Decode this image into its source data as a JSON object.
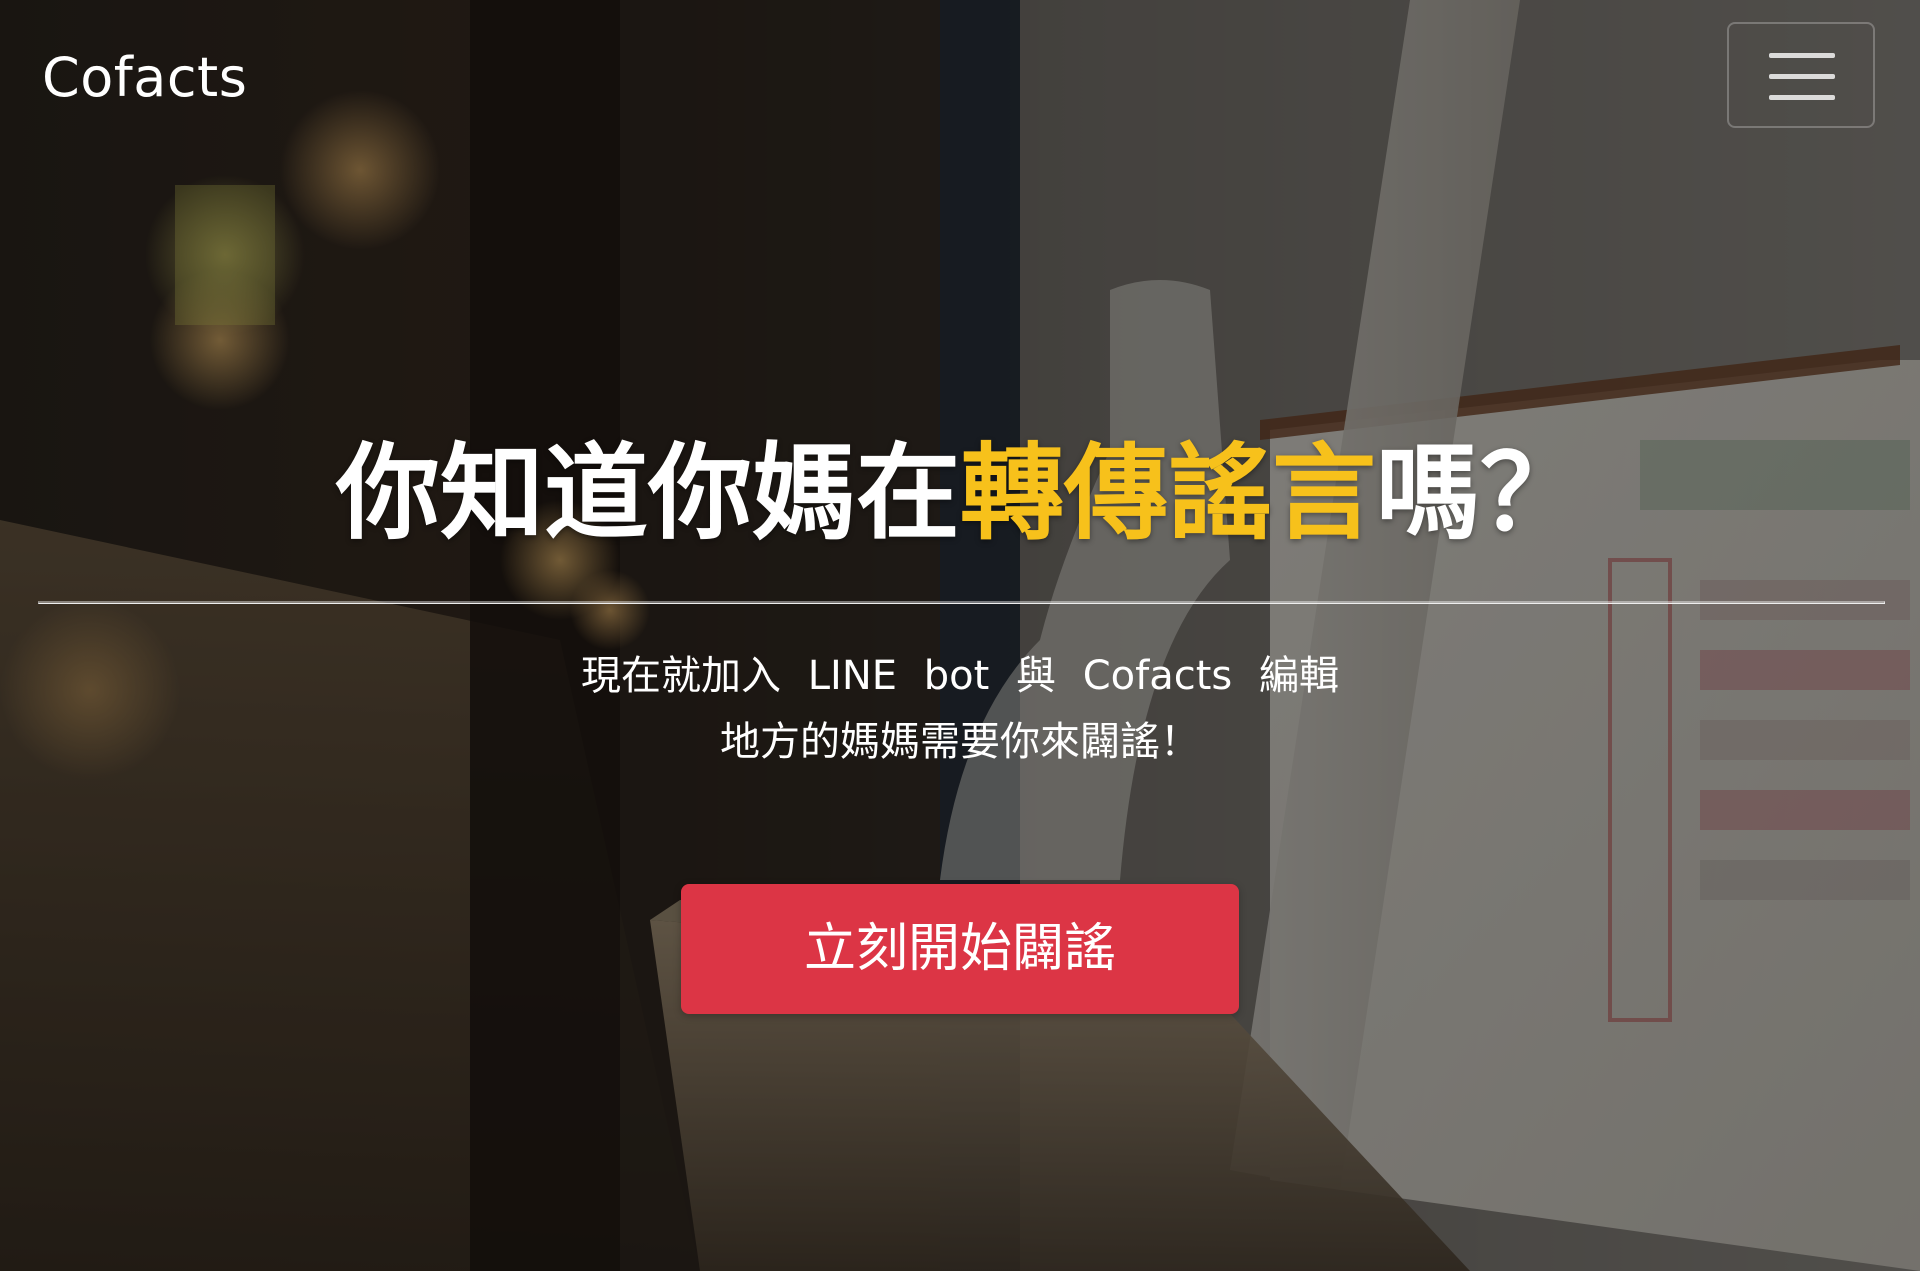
{
  "navbar": {
    "brand": "Cofacts",
    "menu_icon": "hamburger-menu-icon"
  },
  "hero": {
    "headline_before": "你知道你媽在",
    "headline_highlight": "轉傳謠言",
    "headline_after": "嗎？",
    "subtitle_line1": "現在就加入 LINE bot 與 Cofacts 編輯",
    "subtitle_line2": "地方的媽媽需要你來闢謠！",
    "cta_label": "立刻開始闢謠",
    "background_image": "blurred-street-storefront-photo"
  },
  "colors": {
    "highlight": "#f7c11b",
    "cta": "#dc3545",
    "text": "#ffffff"
  }
}
